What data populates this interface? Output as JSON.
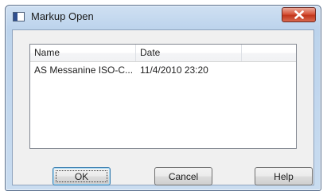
{
  "window": {
    "title": "Markup Open"
  },
  "titlebar": {
    "app_icon": "window-icon",
    "close_icon": "close-icon"
  },
  "list": {
    "columns": [
      "Name",
      "Date",
      ""
    ],
    "rows": [
      {
        "name": "AS Messanine ISO-C...",
        "date": "11/4/2010 23:20"
      }
    ]
  },
  "buttons": {
    "ok": "OK",
    "cancel": "Cancel",
    "help": "Help"
  },
  "colors": {
    "close_button": "#d24a2e",
    "frame": "#c9dcf0"
  }
}
